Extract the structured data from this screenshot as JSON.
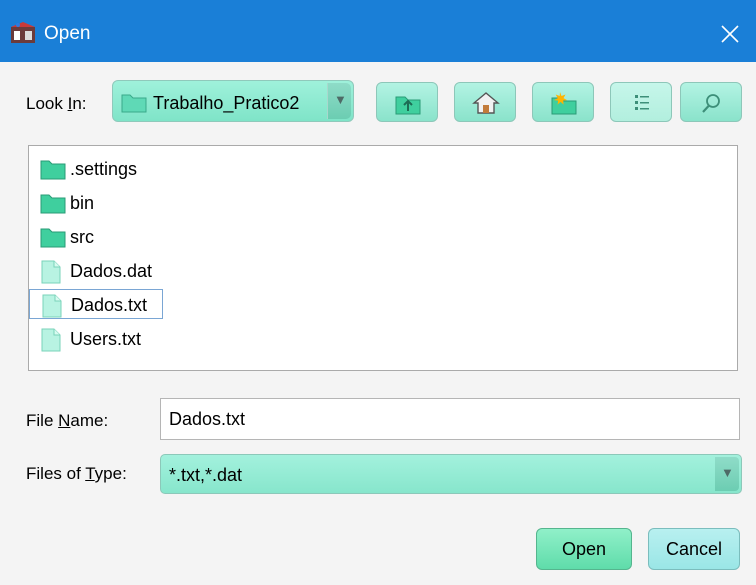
{
  "window": {
    "title": "Open"
  },
  "lookin": {
    "label_pre": "Look ",
    "label_u": "I",
    "label_post": "n:",
    "value": "Trabalho_Pratico2"
  },
  "toolbar": {
    "buttons": [
      {
        "name": "up-one-level",
        "icon": "folder-up-icon"
      },
      {
        "name": "home",
        "icon": "home-icon"
      },
      {
        "name": "create-new-folder",
        "icon": "new-folder-icon"
      },
      {
        "name": "list-view",
        "icon": "list-view-icon"
      },
      {
        "name": "details-view",
        "icon": "details-view-icon"
      }
    ]
  },
  "files": [
    {
      "name": ".settings",
      "type": "folder"
    },
    {
      "name": "bin",
      "type": "folder"
    },
    {
      "name": "src",
      "type": "folder"
    },
    {
      "name": "Dados.dat",
      "type": "file"
    },
    {
      "name": "Dados.txt",
      "type": "file",
      "selected": true
    },
    {
      "name": "Users.txt",
      "type": "file"
    }
  ],
  "filename": {
    "label_pre": "File ",
    "label_u": "N",
    "label_post": "ame:",
    "value": "Dados.txt"
  },
  "filetype": {
    "label_pre": "Files of ",
    "label_u": "T",
    "label_post": "ype:",
    "value": "*.txt,*.dat"
  },
  "buttons": {
    "open": "Open",
    "cancel": "Cancel"
  },
  "colors": {
    "titlebar": "#1a7fd7",
    "accent": "#8ae3cb",
    "open_button": "#5fdcaa",
    "selection_border": "#7aa6d4"
  }
}
